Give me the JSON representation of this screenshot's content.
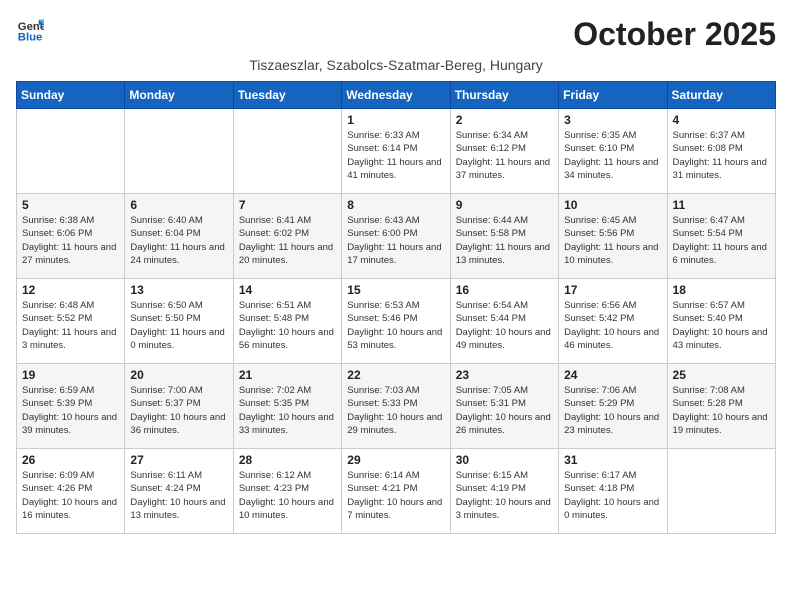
{
  "logo": {
    "line1": "General",
    "line2": "Blue"
  },
  "title": "October 2025",
  "subtitle": "Tiszaeszlar, Szabolcs-Szatmar-Bereg, Hungary",
  "headers": [
    "Sunday",
    "Monday",
    "Tuesday",
    "Wednesday",
    "Thursday",
    "Friday",
    "Saturday"
  ],
  "weeks": [
    [
      {
        "day": "",
        "text": ""
      },
      {
        "day": "",
        "text": ""
      },
      {
        "day": "",
        "text": ""
      },
      {
        "day": "1",
        "text": "Sunrise: 6:33 AM\nSunset: 6:14 PM\nDaylight: 11 hours and 41 minutes."
      },
      {
        "day": "2",
        "text": "Sunrise: 6:34 AM\nSunset: 6:12 PM\nDaylight: 11 hours and 37 minutes."
      },
      {
        "day": "3",
        "text": "Sunrise: 6:35 AM\nSunset: 6:10 PM\nDaylight: 11 hours and 34 minutes."
      },
      {
        "day": "4",
        "text": "Sunrise: 6:37 AM\nSunset: 6:08 PM\nDaylight: 11 hours and 31 minutes."
      }
    ],
    [
      {
        "day": "5",
        "text": "Sunrise: 6:38 AM\nSunset: 6:06 PM\nDaylight: 11 hours and 27 minutes."
      },
      {
        "day": "6",
        "text": "Sunrise: 6:40 AM\nSunset: 6:04 PM\nDaylight: 11 hours and 24 minutes."
      },
      {
        "day": "7",
        "text": "Sunrise: 6:41 AM\nSunset: 6:02 PM\nDaylight: 11 hours and 20 minutes."
      },
      {
        "day": "8",
        "text": "Sunrise: 6:43 AM\nSunset: 6:00 PM\nDaylight: 11 hours and 17 minutes."
      },
      {
        "day": "9",
        "text": "Sunrise: 6:44 AM\nSunset: 5:58 PM\nDaylight: 11 hours and 13 minutes."
      },
      {
        "day": "10",
        "text": "Sunrise: 6:45 AM\nSunset: 5:56 PM\nDaylight: 11 hours and 10 minutes."
      },
      {
        "day": "11",
        "text": "Sunrise: 6:47 AM\nSunset: 5:54 PM\nDaylight: 11 hours and 6 minutes."
      }
    ],
    [
      {
        "day": "12",
        "text": "Sunrise: 6:48 AM\nSunset: 5:52 PM\nDaylight: 11 hours and 3 minutes."
      },
      {
        "day": "13",
        "text": "Sunrise: 6:50 AM\nSunset: 5:50 PM\nDaylight: 11 hours and 0 minutes."
      },
      {
        "day": "14",
        "text": "Sunrise: 6:51 AM\nSunset: 5:48 PM\nDaylight: 10 hours and 56 minutes."
      },
      {
        "day": "15",
        "text": "Sunrise: 6:53 AM\nSunset: 5:46 PM\nDaylight: 10 hours and 53 minutes."
      },
      {
        "day": "16",
        "text": "Sunrise: 6:54 AM\nSunset: 5:44 PM\nDaylight: 10 hours and 49 minutes."
      },
      {
        "day": "17",
        "text": "Sunrise: 6:56 AM\nSunset: 5:42 PM\nDaylight: 10 hours and 46 minutes."
      },
      {
        "day": "18",
        "text": "Sunrise: 6:57 AM\nSunset: 5:40 PM\nDaylight: 10 hours and 43 minutes."
      }
    ],
    [
      {
        "day": "19",
        "text": "Sunrise: 6:59 AM\nSunset: 5:39 PM\nDaylight: 10 hours and 39 minutes."
      },
      {
        "day": "20",
        "text": "Sunrise: 7:00 AM\nSunset: 5:37 PM\nDaylight: 10 hours and 36 minutes."
      },
      {
        "day": "21",
        "text": "Sunrise: 7:02 AM\nSunset: 5:35 PM\nDaylight: 10 hours and 33 minutes."
      },
      {
        "day": "22",
        "text": "Sunrise: 7:03 AM\nSunset: 5:33 PM\nDaylight: 10 hours and 29 minutes."
      },
      {
        "day": "23",
        "text": "Sunrise: 7:05 AM\nSunset: 5:31 PM\nDaylight: 10 hours and 26 minutes."
      },
      {
        "day": "24",
        "text": "Sunrise: 7:06 AM\nSunset: 5:29 PM\nDaylight: 10 hours and 23 minutes."
      },
      {
        "day": "25",
        "text": "Sunrise: 7:08 AM\nSunset: 5:28 PM\nDaylight: 10 hours and 19 minutes."
      }
    ],
    [
      {
        "day": "26",
        "text": "Sunrise: 6:09 AM\nSunset: 4:26 PM\nDaylight: 10 hours and 16 minutes."
      },
      {
        "day": "27",
        "text": "Sunrise: 6:11 AM\nSunset: 4:24 PM\nDaylight: 10 hours and 13 minutes."
      },
      {
        "day": "28",
        "text": "Sunrise: 6:12 AM\nSunset: 4:23 PM\nDaylight: 10 hours and 10 minutes."
      },
      {
        "day": "29",
        "text": "Sunrise: 6:14 AM\nSunset: 4:21 PM\nDaylight: 10 hours and 7 minutes."
      },
      {
        "day": "30",
        "text": "Sunrise: 6:15 AM\nSunset: 4:19 PM\nDaylight: 10 hours and 3 minutes."
      },
      {
        "day": "31",
        "text": "Sunrise: 6:17 AM\nSunset: 4:18 PM\nDaylight: 10 hours and 0 minutes."
      },
      {
        "day": "",
        "text": ""
      }
    ]
  ]
}
